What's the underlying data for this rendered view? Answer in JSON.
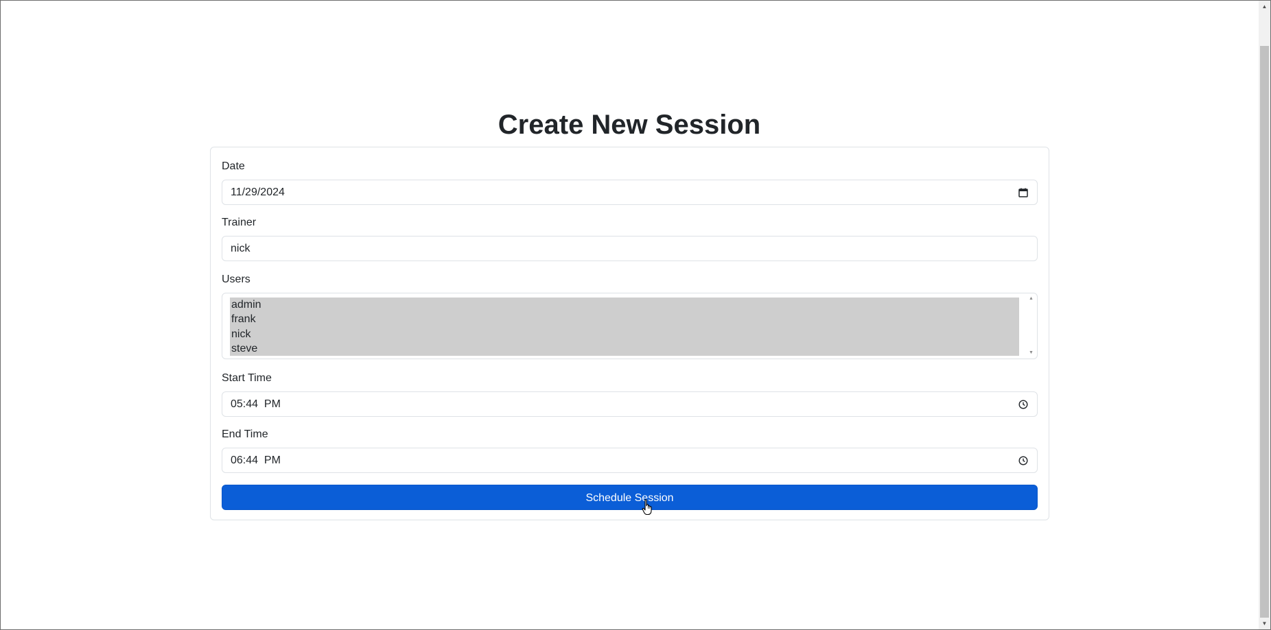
{
  "page": {
    "title": "Create New Session"
  },
  "form": {
    "date": {
      "label": "Date",
      "value": "11/29/2024",
      "icon": "calendar-icon"
    },
    "trainer": {
      "label": "Trainer",
      "value": "nick"
    },
    "users": {
      "label": "Users",
      "options": [
        "admin",
        "frank",
        "nick",
        "steve"
      ],
      "selected_all": true
    },
    "start_time": {
      "label": "Start Time",
      "value": "05:44  PM",
      "icon": "clock-icon"
    },
    "end_time": {
      "label": "End Time",
      "value": "06:44  PM",
      "icon": "clock-icon"
    },
    "submit_label": "Schedule Session"
  },
  "colors": {
    "primary": "#0b5ed7",
    "selected_option_bg": "#cecece",
    "border": "#dee2e6",
    "text": "#212529"
  },
  "cursor": {
    "type": "pointer-hand-icon"
  }
}
